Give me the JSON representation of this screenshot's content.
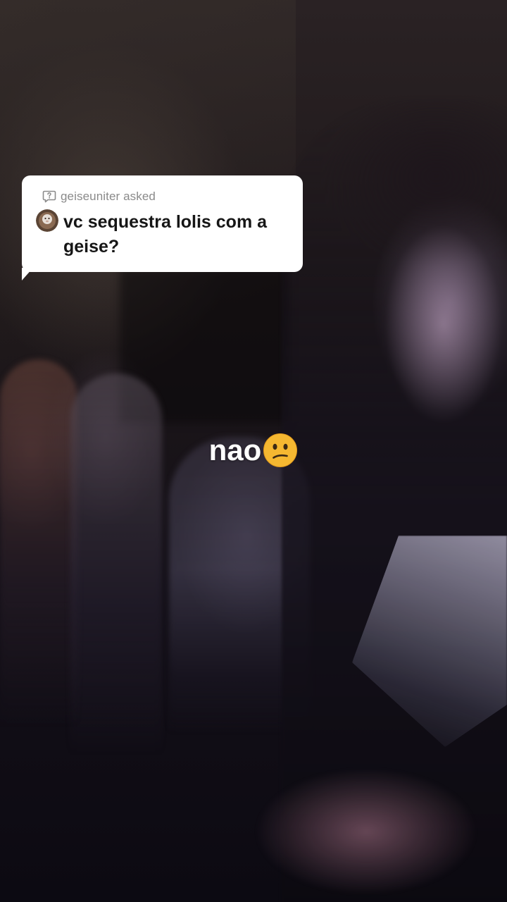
{
  "question_sticker": {
    "asker_label": "geiseuniter asked",
    "question": "vc sequestra lolis com a geise?"
  },
  "caption": {
    "text": "nao",
    "emoji": "confused-face-emoji"
  },
  "icons": {
    "question": "question-bubble-icon",
    "avatar": "asker-avatar"
  },
  "colors": {
    "sticker_bg": "#ffffff",
    "asker_text": "#8a8a8a",
    "question_text": "#161616",
    "caption_text": "#ffffff",
    "emoji_face": "#f5b831"
  }
}
